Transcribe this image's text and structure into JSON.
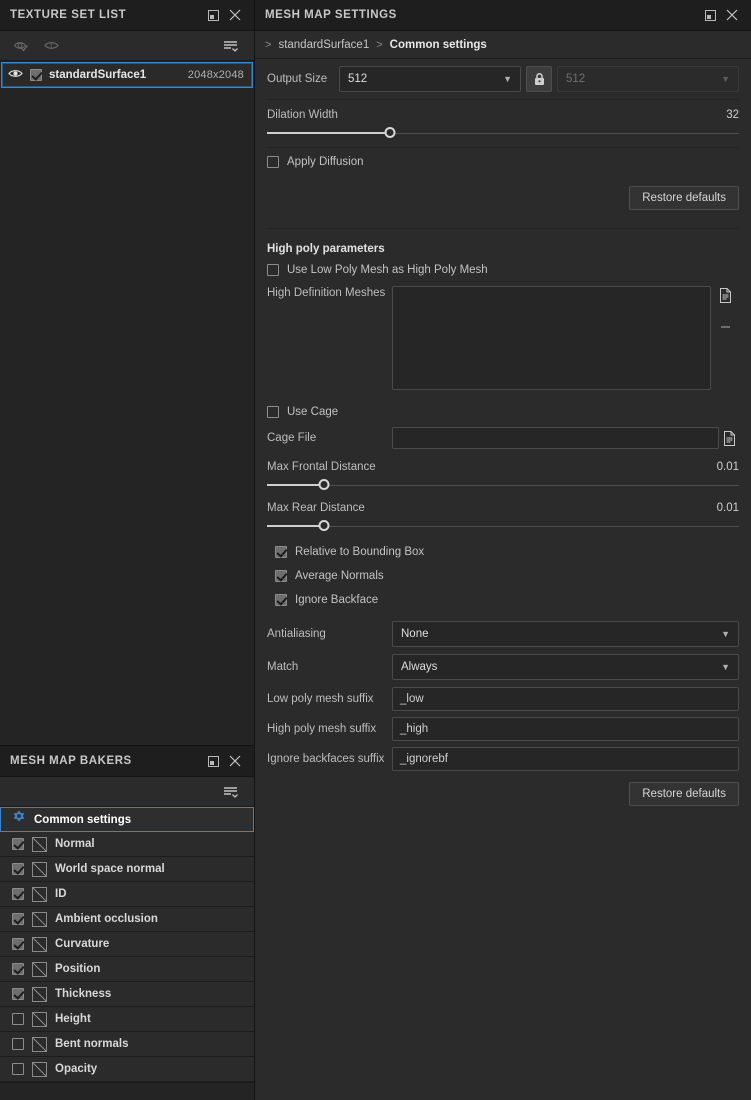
{
  "texture_set_list": {
    "title": "TEXTURE SET LIST",
    "toolbar": {
      "eye_check_icon": "eye-check-icon",
      "eye_one_icon": "eye-one-icon",
      "options_icon": "list-options-icon"
    },
    "rows": [
      {
        "name": "standardSurface1",
        "resolution": "2048x2048",
        "checked": true,
        "visible": true,
        "selected": true
      }
    ]
  },
  "mesh_map_bakers": {
    "title": "MESH MAP BAKERS",
    "toolbar": {
      "options_icon": "list-options-icon"
    },
    "items": [
      {
        "label": "Common settings",
        "type": "settings",
        "selected": true,
        "icon": "gear-icon"
      },
      {
        "label": "Normal",
        "type": "baker",
        "checked": true
      },
      {
        "label": "World space normal",
        "type": "baker",
        "checked": true
      },
      {
        "label": "ID",
        "type": "baker",
        "checked": true
      },
      {
        "label": "Ambient occlusion",
        "type": "baker",
        "checked": true
      },
      {
        "label": "Curvature",
        "type": "baker",
        "checked": true
      },
      {
        "label": "Position",
        "type": "baker",
        "checked": true
      },
      {
        "label": "Thickness",
        "type": "baker",
        "checked": true
      },
      {
        "label": "Height",
        "type": "baker",
        "checked": false
      },
      {
        "label": "Bent normals",
        "type": "baker",
        "checked": false
      },
      {
        "label": "Opacity",
        "type": "baker",
        "checked": false
      }
    ]
  },
  "mesh_map_settings": {
    "title": "MESH MAP SETTINGS",
    "breadcrumb": {
      "root": "standardSurface1",
      "current": "Common settings",
      "separator": ">"
    },
    "output_size": {
      "label": "Output Size",
      "width_value": "512",
      "height_value": "512",
      "lock_icon": "lock-icon",
      "locked": true
    },
    "dilation_width": {
      "label": "Dilation Width",
      "value": "32",
      "percent": 26
    },
    "apply_diffusion": {
      "label": "Apply Diffusion",
      "checked": false
    },
    "restore_defaults_top": "Restore defaults",
    "high_poly_parameters": {
      "section_title": "High poly parameters",
      "use_low_poly": {
        "label": "Use Low Poly Mesh as High Poly Mesh",
        "checked": false
      },
      "high_definition_meshes": {
        "label": "High Definition Meshes",
        "value": "",
        "add_icon": "file-add-icon",
        "remove_icon": "minus-icon"
      },
      "use_cage": {
        "label": "Use Cage",
        "checked": false
      },
      "cage_file": {
        "label": "Cage File",
        "value": "",
        "browse_icon": "file-icon"
      },
      "max_frontal_distance": {
        "label": "Max Frontal Distance",
        "value": "0.01",
        "percent": 12
      },
      "max_rear_distance": {
        "label": "Max Rear Distance",
        "value": "0.01",
        "percent": 12
      },
      "relative_bbox": {
        "label": "Relative to Bounding Box",
        "checked": true
      },
      "average_normals": {
        "label": "Average Normals",
        "checked": true
      },
      "ignore_backface": {
        "label": "Ignore Backface",
        "checked": true
      },
      "antialiasing": {
        "label": "Antialiasing",
        "value": "None"
      },
      "match": {
        "label": "Match",
        "value": "Always"
      },
      "low_poly_suffix": {
        "label": "Low poly mesh suffix",
        "value": "_low"
      },
      "high_poly_suffix": {
        "label": "High poly mesh suffix",
        "value": "_high"
      },
      "ignore_backfaces_suffix": {
        "label": "Ignore backfaces suffix",
        "value": "_ignorebf"
      },
      "restore_defaults": "Restore defaults"
    }
  },
  "colors": {
    "accent": "#3b86c8",
    "panel_bg": "#2b2b2b",
    "sidebar_bg": "#242424",
    "titlebar_bg": "#1e1e1e",
    "text": "#c8c8c8"
  }
}
